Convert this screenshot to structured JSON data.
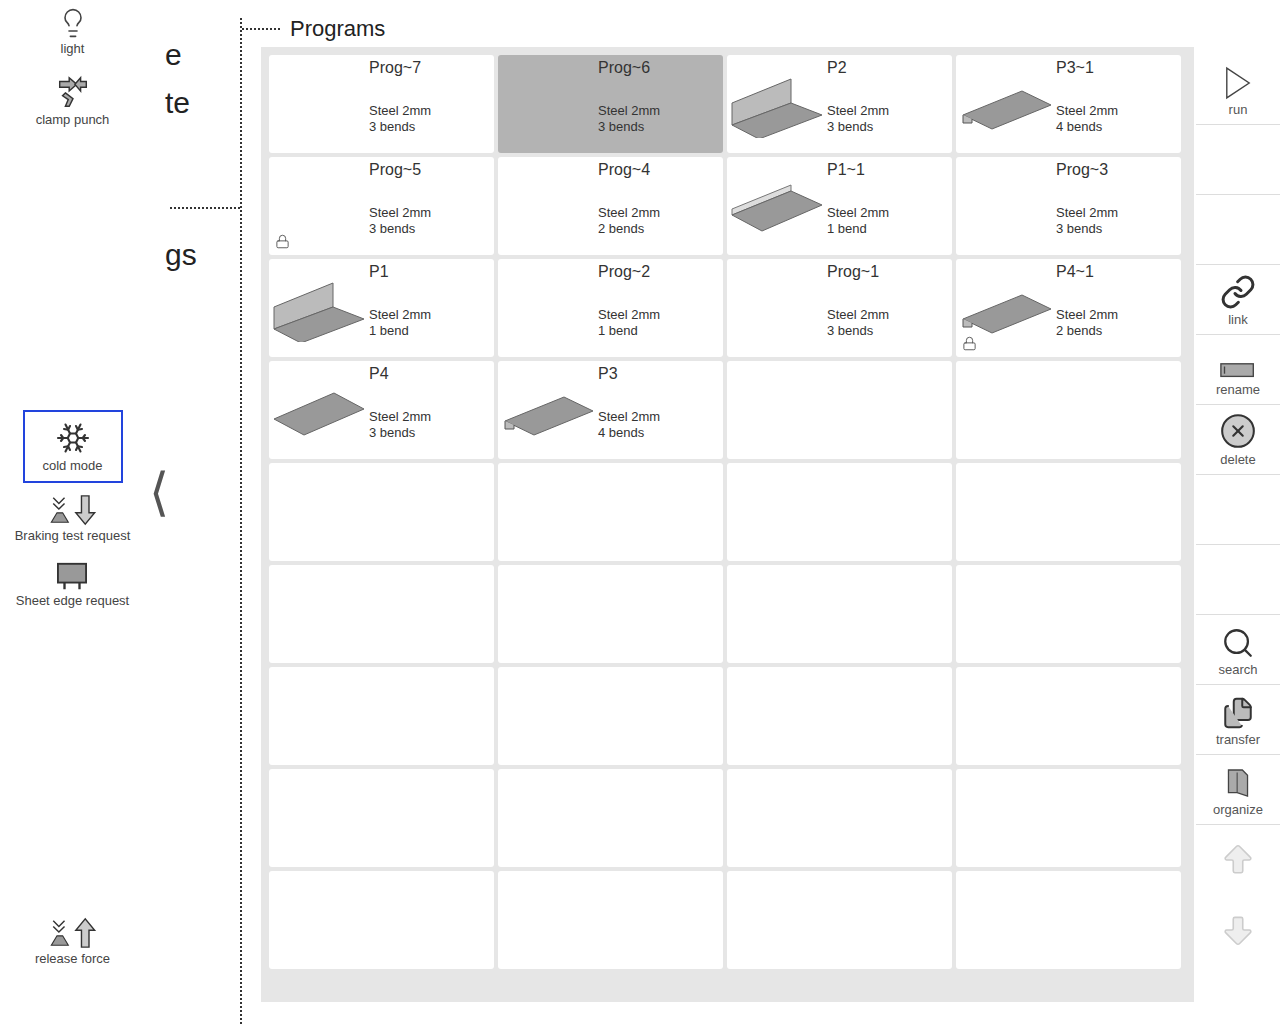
{
  "left_toolbar": {
    "top": [
      {
        "label": "light",
        "selected": false
      },
      {
        "label": "clamp punch",
        "selected": false
      }
    ],
    "middle": [
      {
        "label": "cold mode",
        "selected": true
      },
      {
        "label": "Braking test request",
        "selected": false
      },
      {
        "label": "Sheet edge request",
        "selected": false
      }
    ],
    "bottom": [
      {
        "label": "release force",
        "selected": false
      }
    ]
  },
  "background_fragments": [
    "e",
    "te",
    "gs"
  ],
  "collapse_arrow": "⟨",
  "panel": {
    "title": "Programs"
  },
  "programs": [
    {
      "name": "Prog~7",
      "material": "Steel 2mm",
      "bends": "3 bends",
      "selected": false,
      "locked": false,
      "preview": "none"
    },
    {
      "name": "Prog~6",
      "material": "Steel 2mm",
      "bends": "3 bends",
      "selected": true,
      "locked": false,
      "preview": "none"
    },
    {
      "name": "P2",
      "material": "Steel 2mm",
      "bends": "3 bends",
      "selected": false,
      "locked": false,
      "preview": "angle"
    },
    {
      "name": "P3~1",
      "material": "Steel 2mm",
      "bends": "4 bends",
      "selected": false,
      "locked": false,
      "preview": "hem"
    },
    {
      "name": "Prog~5",
      "material": "Steel 2mm",
      "bends": "3 bends",
      "selected": false,
      "locked": true,
      "preview": "none"
    },
    {
      "name": "Prog~4",
      "material": "Steel 2mm",
      "bends": "2 bends",
      "selected": false,
      "locked": false,
      "preview": "none"
    },
    {
      "name": "P1~1",
      "material": "Steel 2mm",
      "bends": "1 bend",
      "selected": false,
      "locked": false,
      "preview": "lip"
    },
    {
      "name": "Prog~3",
      "material": "Steel 2mm",
      "bends": "3 bends",
      "selected": false,
      "locked": false,
      "preview": "none"
    },
    {
      "name": "P1",
      "material": "Steel 2mm",
      "bends": "1 bend",
      "selected": false,
      "locked": false,
      "preview": "angle"
    },
    {
      "name": "Prog~2",
      "material": "Steel 2mm",
      "bends": "1 bend",
      "selected": false,
      "locked": false,
      "preview": "none"
    },
    {
      "name": "Prog~1",
      "material": "Steel 2mm",
      "bends": "3 bends",
      "selected": false,
      "locked": false,
      "preview": "none"
    },
    {
      "name": "P4~1",
      "material": "Steel 2mm",
      "bends": "2 bends",
      "selected": false,
      "locked": true,
      "preview": "hem"
    },
    {
      "name": "P4",
      "material": "Steel 2mm",
      "bends": "3 bends",
      "selected": false,
      "locked": false,
      "preview": "flat"
    },
    {
      "name": "P3",
      "material": "Steel 2mm",
      "bends": "4 bends",
      "selected": false,
      "locked": false,
      "preview": "hem"
    }
  ],
  "right_toolbar": [
    {
      "kind": "button",
      "label": "run",
      "disabled": false
    },
    {
      "kind": "spacer"
    },
    {
      "kind": "spacer"
    },
    {
      "kind": "button",
      "label": "link",
      "disabled": false
    },
    {
      "kind": "button",
      "label": "rename",
      "disabled": false
    },
    {
      "kind": "button",
      "label": "delete",
      "disabled": false
    },
    {
      "kind": "spacer"
    },
    {
      "kind": "spacer"
    },
    {
      "kind": "button",
      "label": "search",
      "disabled": false
    },
    {
      "kind": "button",
      "label": "transfer",
      "disabled": false
    },
    {
      "kind": "button",
      "label": "organize",
      "disabled": false
    },
    {
      "kind": "arrow",
      "label": "",
      "disabled": true
    },
    {
      "kind": "arrow",
      "label": "",
      "disabled": true
    }
  ]
}
